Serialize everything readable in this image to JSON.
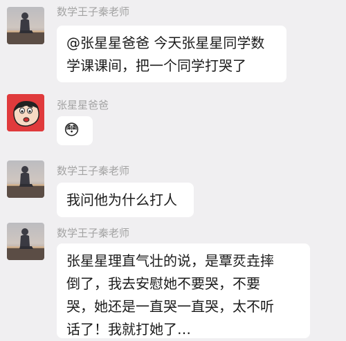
{
  "messages": [
    {
      "sender": "数学王子秦老师",
      "avatar_icon": "person-sitting-dusk-icon",
      "lines": [
        "@张星星爸爸 今天张星星同学数",
        "学课课间，把一个同学打哭了"
      ]
    },
    {
      "sender": "张星星爸爸",
      "avatar_icon": "crayon-shinchan-icon",
      "lines": [
        "😳"
      ]
    },
    {
      "sender": "数学王子秦老师",
      "avatar_icon": "person-sitting-dusk-icon",
      "lines": [
        "我问他为什么打人"
      ]
    },
    {
      "sender": "数学王子秦老师",
      "avatar_icon": "person-sitting-dusk-icon",
      "lines": [
        "张星星理直气壮的说，是覃烎垚摔",
        "倒了，我去安慰她不要哭，不要",
        "哭，她还是一直哭一直哭，太不听",
        "话了！我就打她了…"
      ]
    }
  ],
  "colors": {
    "background": "#f0eff1",
    "bubble": "#ffffff",
    "sender_name": "#a3a3a3",
    "text": "#1b1b1b"
  }
}
